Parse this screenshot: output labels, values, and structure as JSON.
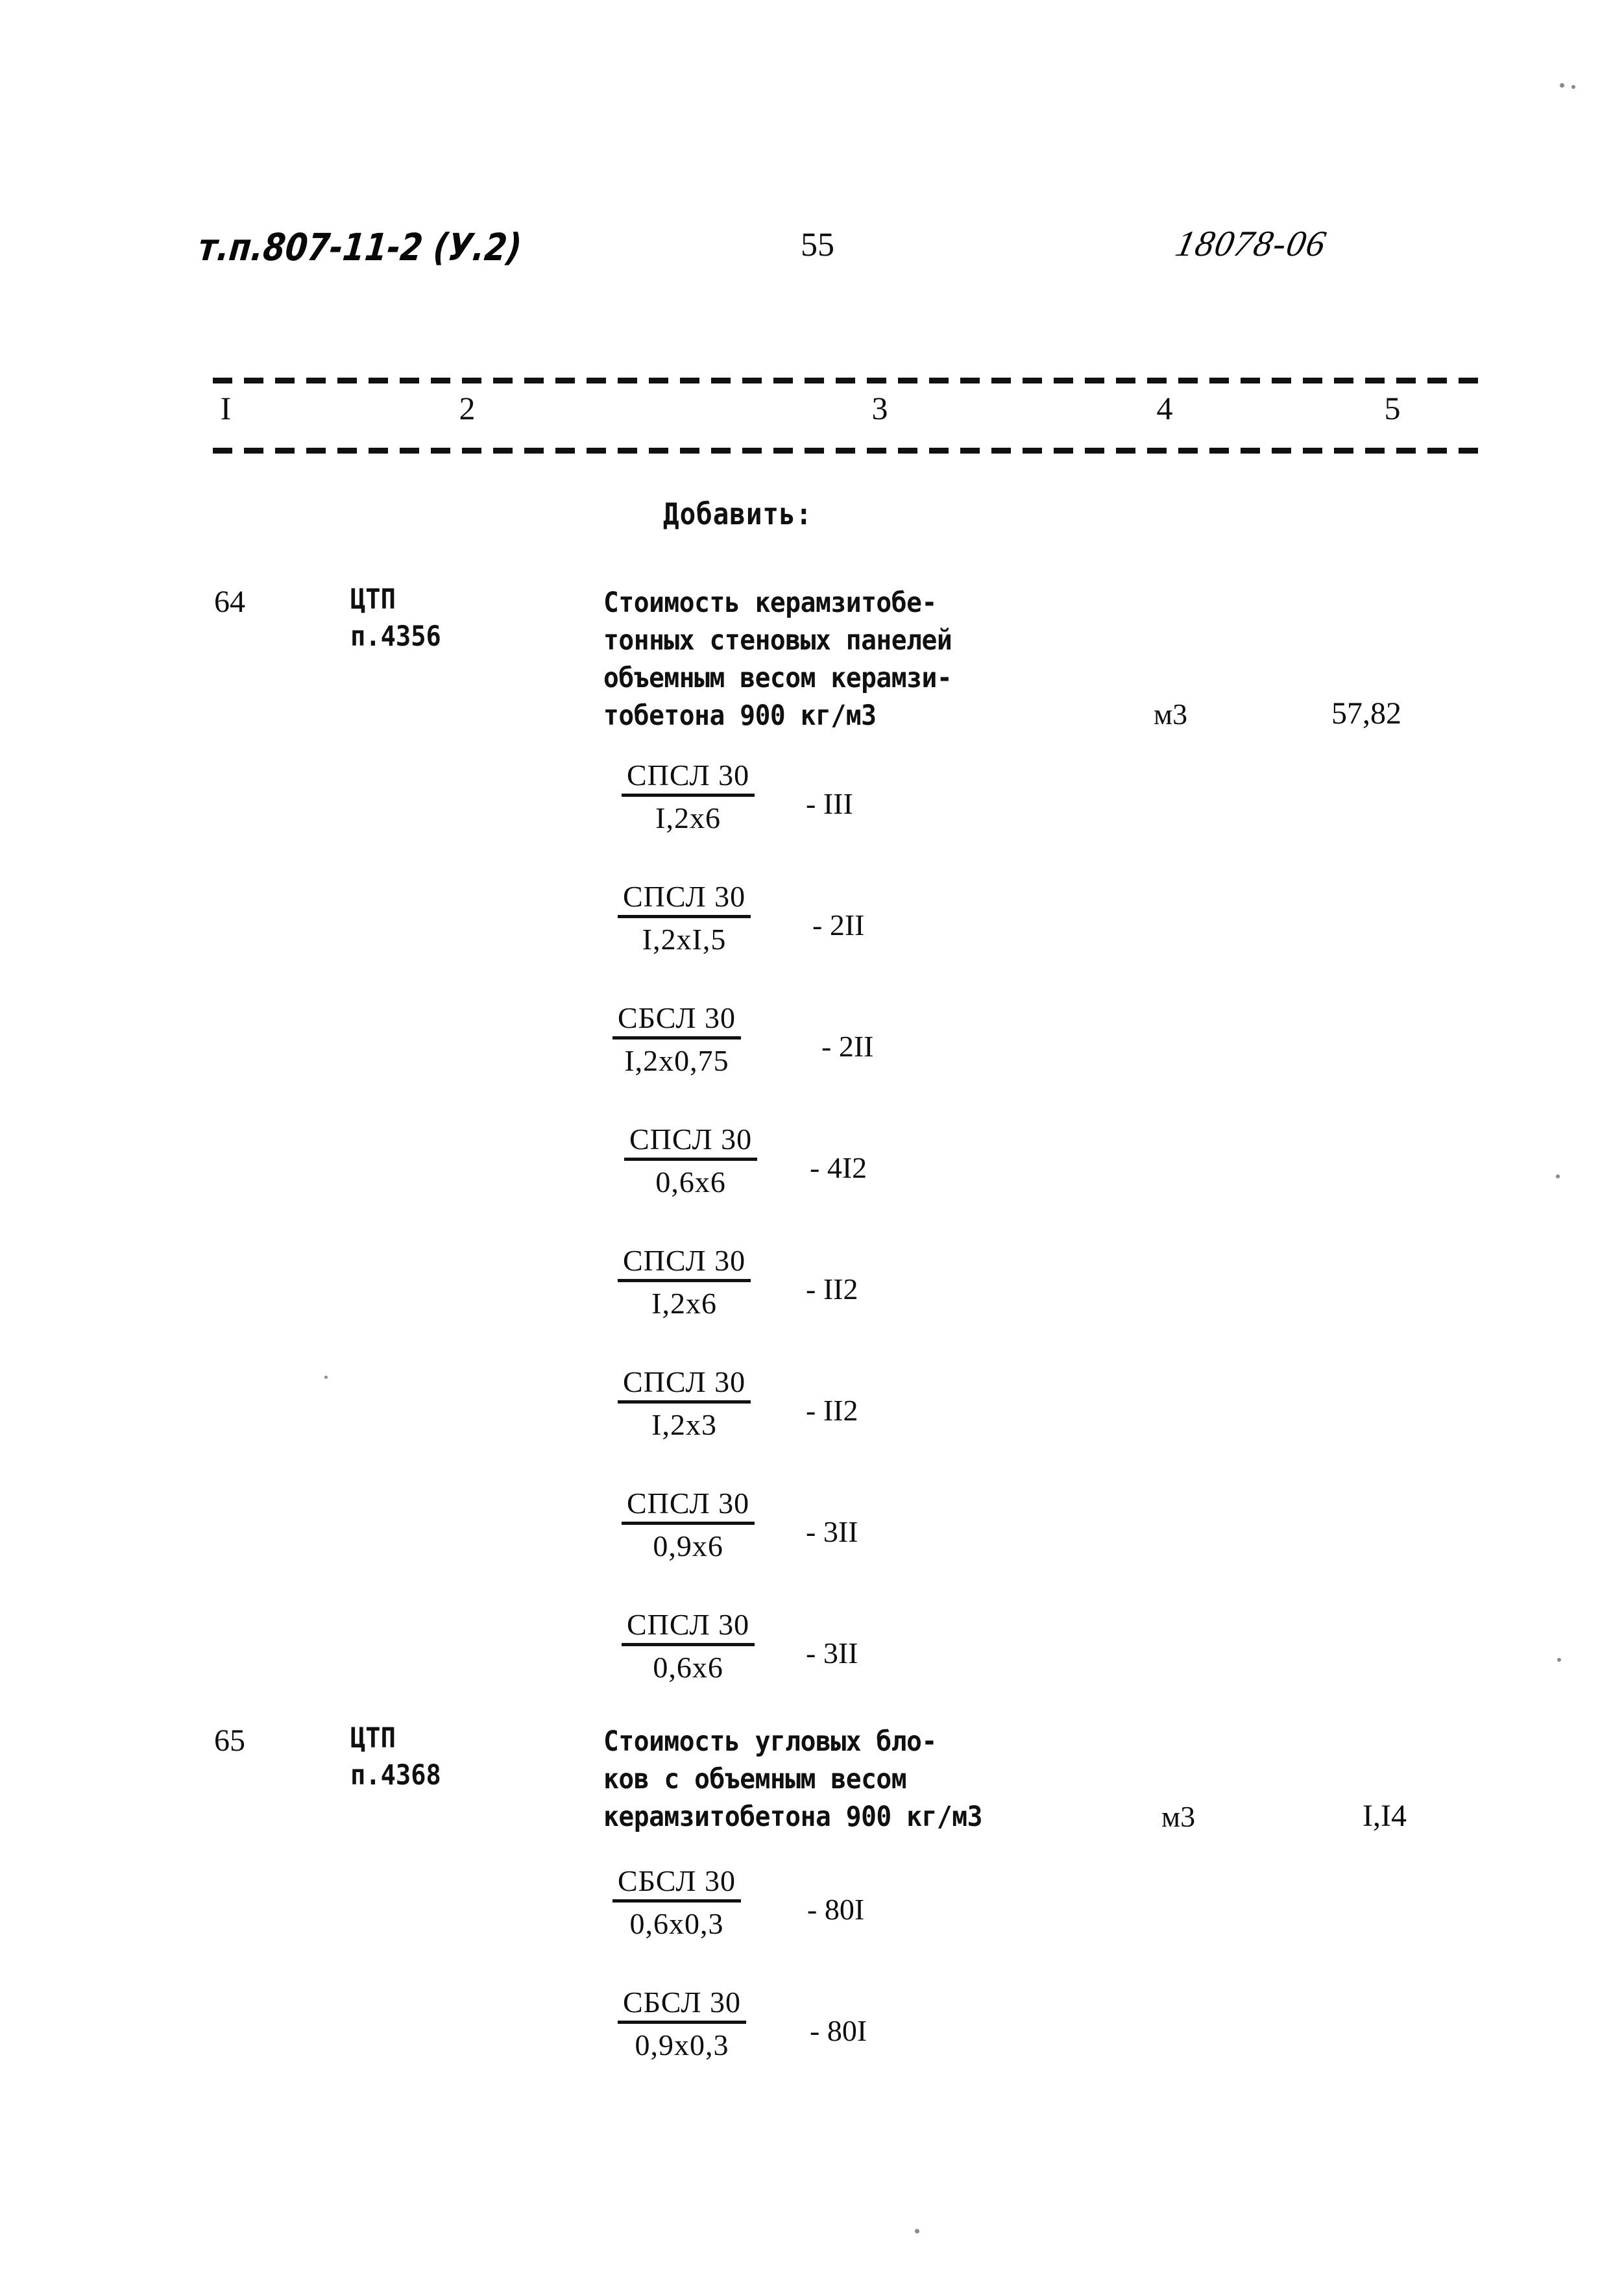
{
  "header": {
    "doc_code": "т.п.807-11-2 (У.2)",
    "page_number": "55",
    "sheet_code": "18078-06"
  },
  "table": {
    "column_numbers": [
      "I",
      "2",
      "3",
      "4",
      "5"
    ],
    "section_label": "Добавить:",
    "rows": [
      {
        "num": "64",
        "ref_line1": "ЦТП",
        "ref_line2": "п.4356",
        "description": "Стоимость керамзитобе-\nтонных стеновых панелей\nобъемным весом керамзи-\nтобетона 900 кг/м3",
        "unit": "м3",
        "price": "57,82",
        "items": [
          {
            "numerator": "СПСЛ 30",
            "denominator": "I,2x6",
            "mark": "- III"
          },
          {
            "numerator": "СПСЛ 30",
            "denominator": "I,2xI,5",
            "mark": "- 2II"
          },
          {
            "numerator": "СБСЛ 30",
            "denominator": "I,2x0,75",
            "mark": "- 2II"
          },
          {
            "numerator": "СПСЛ 30",
            "denominator": "0,6x6",
            "mark": "- 4I2"
          },
          {
            "numerator": "СПСЛ 30",
            "denominator": "I,2x6",
            "mark": "- II2"
          },
          {
            "numerator": "СПСЛ 30",
            "denominator": "I,2x3",
            "mark": "- II2"
          },
          {
            "numerator": "СПСЛ 30",
            "denominator": "0,9x6",
            "mark": "- 3II"
          },
          {
            "numerator": "СПСЛ 30",
            "denominator": "0,6x6",
            "mark": "- 3II"
          }
        ]
      },
      {
        "num": "65",
        "ref_line1": "ЦТП",
        "ref_line2": "п.4368",
        "description": "Стоимость угловых бло-\nков с объемным весом\nкерамзитобетона 900 кг/м3",
        "unit": "м3",
        "price": "I,I4",
        "items": [
          {
            "numerator": "СБСЛ 30",
            "denominator": "0,6x0,3",
            "mark": "- 80I"
          },
          {
            "numerator": "СБСЛ 30",
            "denominator": "0,9x0,3",
            "mark": "- 80I"
          }
        ]
      }
    ]
  }
}
